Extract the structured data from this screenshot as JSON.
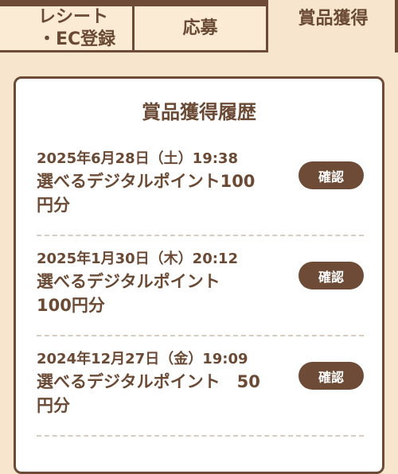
{
  "tabs": {
    "tab1_line1": "レシート",
    "tab1_line2": "・EC登録",
    "tab2": "応募",
    "tab3": "賞品獲得"
  },
  "panel": {
    "title": "賞品獲得履歴",
    "entries": [
      {
        "date": "2025年6月28日（土）19:38",
        "prize": "選べるデジタルポイント100円分",
        "button": "確認"
      },
      {
        "date": "2025年1月30日（木）20:12",
        "prize": "選べるデジタルポイント　100円分",
        "button": "確認"
      },
      {
        "date": "2024年12月27日（金）19:09",
        "prize": "選べるデジタルポイント　50円分",
        "button": "確認"
      }
    ]
  },
  "colors": {
    "background": "#f7e6cd",
    "brown": "#6d4b37",
    "text": "#6b4a35",
    "panel": "#ffffff"
  }
}
